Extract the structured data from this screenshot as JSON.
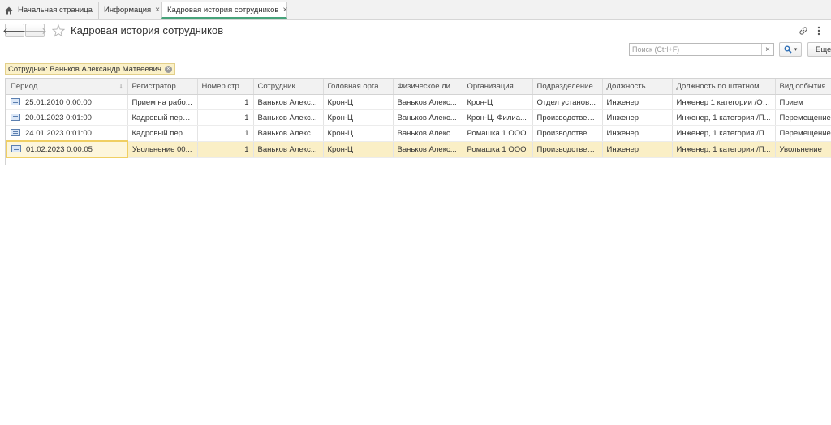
{
  "tabs": [
    {
      "label": "Начальная страница",
      "icon": "home-icon"
    },
    {
      "label": "Информация",
      "close": "×"
    },
    {
      "label": "Кадровая история сотрудников",
      "close": "×"
    }
  ],
  "nav": {
    "back": "🡐",
    "forward": "🡒"
  },
  "page_title": "Кадровая история сотрудников",
  "toolbar": {
    "search_placeholder": "Поиск (Ctrl+F)",
    "clear": "×",
    "search_dropdown": "▾",
    "more_label": "Еще"
  },
  "filter": {
    "label": "Сотрудник: Ваньков Александр Матвеевич",
    "remove": "×"
  },
  "table": {
    "sort_indicator": "↓",
    "columns": [
      "Период",
      "Регистратор",
      "Номер строки",
      "Сотрудник",
      "Головная орган...",
      "Физическое лицо",
      "Организация",
      "Подразделение",
      "Должность",
      "Должность по штатному ...",
      "Вид события"
    ],
    "rows": [
      [
        "25.01.2010 0:00:00",
        "Прием на рабо...",
        "1",
        "Ваньков Алекс...",
        "Крон-Ц",
        "Ваньков Алекс...",
        "Крон-Ц",
        "Отдел установ...",
        "Инженер",
        "Инженер 1 категории /От...",
        "Прием"
      ],
      [
        "20.01.2023 0:01:00",
        "Кадровый пере...",
        "1",
        "Ваньков Алекс...",
        "Крон-Ц",
        "Ваньков Алекс...",
        "Крон-Ц. Филиа...",
        "Производствен...",
        "Инженер",
        "Инженер, 1 категория /П...",
        "Перемещение"
      ],
      [
        "24.01.2023 0:01:00",
        "Кадровый пере...",
        "1",
        "Ваньков Алекс...",
        "Крон-Ц",
        "Ваньков Алекс...",
        "Ромашка 1 ООО",
        "Производствен...",
        "Инженер",
        "Инженер, 1 категория /П...",
        "Перемещение"
      ],
      [
        "01.02.2023 0:00:05",
        "Увольнение 00...",
        "1",
        "Ваньков Алекс...",
        "Крон-Ц",
        "Ваньков Алекс...",
        "Ромашка 1 ООО",
        "Производствен...",
        "Инженер",
        "Инженер, 1 категория /П...",
        "Увольнение"
      ]
    ],
    "selected_row": 3
  },
  "colors": {
    "accent": "#46a37a",
    "selection": "#faefc6",
    "filter_bg": "#fbf1c8"
  }
}
